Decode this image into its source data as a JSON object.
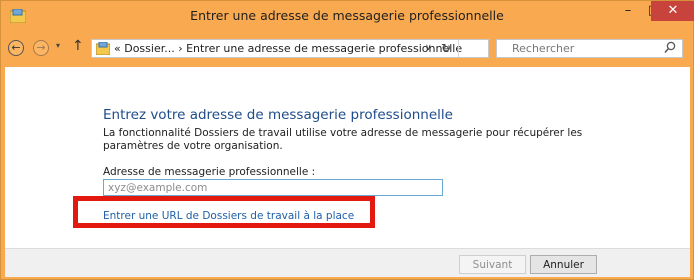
{
  "window": {
    "title": "Entrer une adresse de messagerie professionnelle",
    "minimize_glyph": "–",
    "maximize_glyph": "□",
    "close_glyph": "✕",
    "accent_color": "#f9a94f"
  },
  "nav": {
    "back_glyph": "←",
    "forward_glyph": "→",
    "dropdown_glyph": "▾",
    "up_glyph": "↑",
    "breadcrumb": "« Dossier... ›  Entrer une adresse de messagerie professionnelle",
    "breadcrumb_dropdown_glyph": "∨",
    "refresh_glyph": "↻",
    "search_placeholder": "Rechercher",
    "search_icon": "search-icon"
  },
  "content": {
    "heading": "Entrez votre adresse de messagerie professionnelle",
    "description": "La fonctionnalité Dossiers de travail utilise votre adresse de messagerie pour récupérer les paramètres de votre organisation.",
    "email_label": "Adresse de messagerie professionnelle :",
    "email_placeholder": "xyz@example.com",
    "email_value": "",
    "alt_link": "Entrer une URL de Dossiers de travail à la place",
    "highlight_color": "#e3190f"
  },
  "footer": {
    "next_label": "Suivant",
    "cancel_label": "Annuler"
  }
}
